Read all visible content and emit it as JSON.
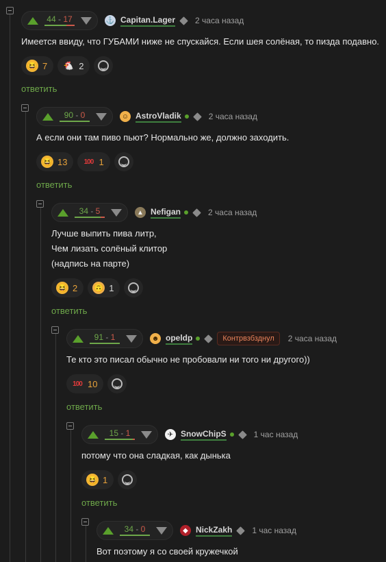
{
  "comments": [
    {
      "score_pos": "44",
      "score_neg": "17",
      "score_ratio": 0.72,
      "username": "Capitan.Lager",
      "avatar": "capitan-lager-avatar",
      "online": false,
      "timestamp": "2 часа назад",
      "badge": "",
      "lines": [
        "Имеется ввиду, что ГУБАМИ ниже не спускайся. Если шея солёная, то пизда подавно."
      ],
      "reactions": [
        {
          "emoji": "laughing",
          "count": "7"
        },
        {
          "emoji": "chicken",
          "count": "2"
        }
      ],
      "reply_label": "ответить"
    },
    {
      "score_pos": "90",
      "score_neg": "0",
      "score_ratio": 1.0,
      "username": "AstroVladik",
      "avatar": "astrovladik-avatar",
      "online": true,
      "timestamp": "2 часа назад",
      "badge": "",
      "lines": [
        "А если они там пиво пьют? Нормально же, должно заходить."
      ],
      "reactions": [
        {
          "emoji": "laughing",
          "count": "13"
        },
        {
          "emoji": "hundred",
          "count": "1"
        }
      ],
      "reply_label": "ответить"
    },
    {
      "score_pos": "34",
      "score_neg": "5",
      "score_ratio": 0.87,
      "username": "Nefigan",
      "avatar": "nefigan-avatar",
      "online": true,
      "timestamp": "2 часа назад",
      "badge": "",
      "lines": [
        "Лучше выпить пива литр,",
        "Чем лизать солёный клитор",
        "(надпись на парте)"
      ],
      "reactions": [
        {
          "emoji": "laughing",
          "count": "2"
        },
        {
          "emoji": "smirk",
          "count": "1"
        }
      ],
      "reply_label": "ответить"
    },
    {
      "score_pos": "91",
      "score_neg": "1",
      "score_ratio": 0.99,
      "username": "opeldp",
      "avatar": "opeldp-avatar",
      "online": true,
      "timestamp": "2 часа назад",
      "badge": "Контрвзбзднул",
      "lines": [
        "Те кто это писал обычно не пробовали ни того ни другого))"
      ],
      "reactions": [
        {
          "emoji": "hundred",
          "count": "10"
        }
      ],
      "reply_label": "ответить"
    },
    {
      "score_pos": "15",
      "score_neg": "1",
      "score_ratio": 0.94,
      "username": "SnowChipS",
      "avatar": "snowchips-avatar",
      "online": true,
      "timestamp": "1 час назад",
      "badge": "",
      "lines": [
        "потому что она сладкая, как дынька"
      ],
      "reactions": [
        {
          "emoji": "laughing",
          "count": "1"
        }
      ],
      "reply_label": "ответить"
    },
    {
      "score_pos": "34",
      "score_neg": "0",
      "score_ratio": 1.0,
      "username": "NickZakh",
      "avatar": "nickzakh-avatar",
      "online": false,
      "timestamp": "1 час назад",
      "badge": "",
      "lines": [
        "Вот поэтому я со своей кружечкой"
      ],
      "reactions": [],
      "reply_label": ""
    }
  ],
  "colors": {
    "accent": "#6ea84a",
    "negative": "#cc5a4a",
    "background": "#1c1c1c"
  }
}
